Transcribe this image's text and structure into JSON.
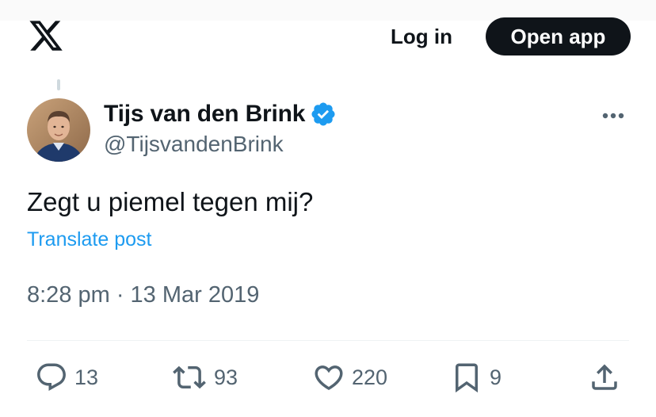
{
  "header": {
    "logo_icon": "x-logo-icon",
    "login_label": "Log in",
    "open_app_label": "Open app"
  },
  "post": {
    "author_name": "Tijs van den Brink",
    "author_handle": "@TijsvandenBrink",
    "verified": true,
    "verified_color": "#1d9bf0",
    "text": "Zegt u piemel tegen mij?",
    "translate_label": "Translate post",
    "timestamp": "8:28 pm · 13 Mar 2019",
    "more_icon": "more-horizontal-icon"
  },
  "actions": {
    "replies": "13",
    "reposts": "93",
    "likes": "220",
    "bookmarks": "9",
    "reply_icon": "reply-icon",
    "repost_icon": "repost-icon",
    "like_icon": "heart-icon",
    "bookmark_icon": "bookmark-icon",
    "share_icon": "share-icon"
  },
  "colors": {
    "text_primary": "#0f1419",
    "text_secondary": "#536471",
    "accent": "#1d9bf0",
    "button_dark": "#0f1419"
  }
}
